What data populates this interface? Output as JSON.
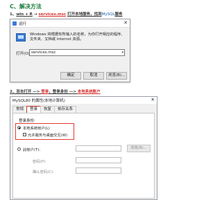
{
  "section_title": "C、解决方法",
  "step1": {
    "num": "1、",
    "key": "win + R",
    "arrow1": "→",
    "cmd": "services.msc",
    "text_a": "打开本地服务，找到",
    "service": "MySQL",
    "text_b": "服务"
  },
  "step2": {
    "text_a": "2、双击打开 —> ",
    "login": "登录",
    "text_b": "，登录身份 —> ",
    "local": "本地系统账户"
  },
  "run_dialog": {
    "title": "运行",
    "close": "✕",
    "description": "Windows 将根据你所输入的名称，为你打开相应的程序、文件夹、文档或 Internet 资源。",
    "open_label": "打开(O):",
    "open_value": "services.msc",
    "dropdown": "▾",
    "buttons": [
      "确定",
      "取消",
      "浏览(B)..."
    ]
  },
  "properties_dialog": {
    "title": "MySQL80 的属性(本地计算机)",
    "close": "✕",
    "tabs": [
      "常规",
      "登录",
      "恢复",
      "依存关系"
    ],
    "active_tab": 1,
    "logon_as_label": "登录身份:",
    "local_system_account": "本地系统帐户(L)",
    "allow_desktop": "允许服务与桌面交互(W)",
    "this_account": "此帐户(T):",
    "password": "密码(P):",
    "confirm_password": "确认密码(C):",
    "browse": "浏览(B)..."
  },
  "colors": {
    "title_green": "#1e7c3b",
    "highlight_red": "#e03a30",
    "link_blue": "#1a59b5"
  }
}
